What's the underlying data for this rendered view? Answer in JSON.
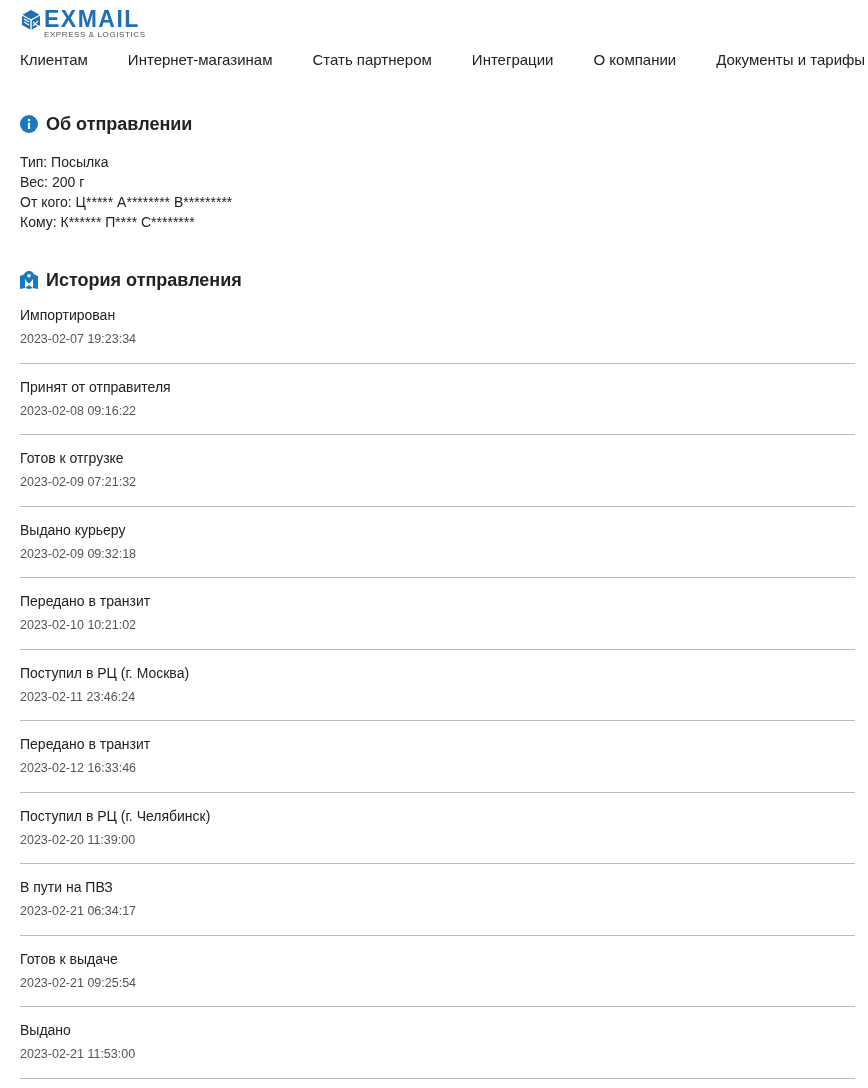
{
  "logo": {
    "name": "EXMAIL",
    "tagline": "EXPRESS & LOGISTICS"
  },
  "nav": [
    "Клиентам",
    "Интернет-магазинам",
    "Стать партнером",
    "Интеграции",
    "О компании",
    "Документы и тарифы"
  ],
  "shipment_info": {
    "title": "Об отправлении",
    "lines": [
      "Тип: Посылка",
      "Вес: 200 г",
      "От кого: Ц***** А******** В*********",
      "Кому: К****** П**** С********"
    ]
  },
  "history": {
    "title": "История отправления",
    "events": [
      {
        "status": "Импортирован",
        "time": "2023-02-07 19:23:34"
      },
      {
        "status": "Принят от отправителя",
        "time": "2023-02-08 09:16:22"
      },
      {
        "status": "Готов к отгрузке",
        "time": "2023-02-09 07:21:32"
      },
      {
        "status": "Выдано курьеру",
        "time": "2023-02-09 09:32:18"
      },
      {
        "status": "Передано в транзит",
        "time": "2023-02-10 10:21:02"
      },
      {
        "status": "Поступил в РЦ (г. Москва)",
        "time": "2023-02-11 23:46:24"
      },
      {
        "status": "Передано в транзит",
        "time": "2023-02-12 16:33:46"
      },
      {
        "status": "Поступил в РЦ (г. Челябинск)",
        "time": "2023-02-20 11:39:00"
      },
      {
        "status": "В пути на ПВЗ",
        "time": "2023-02-21 06:34:17"
      },
      {
        "status": "Готов к выдаче",
        "time": "2023-02-21 09:25:54"
      },
      {
        "status": "Выдано",
        "time": "2023-02-21 11:53:00"
      }
    ]
  }
}
